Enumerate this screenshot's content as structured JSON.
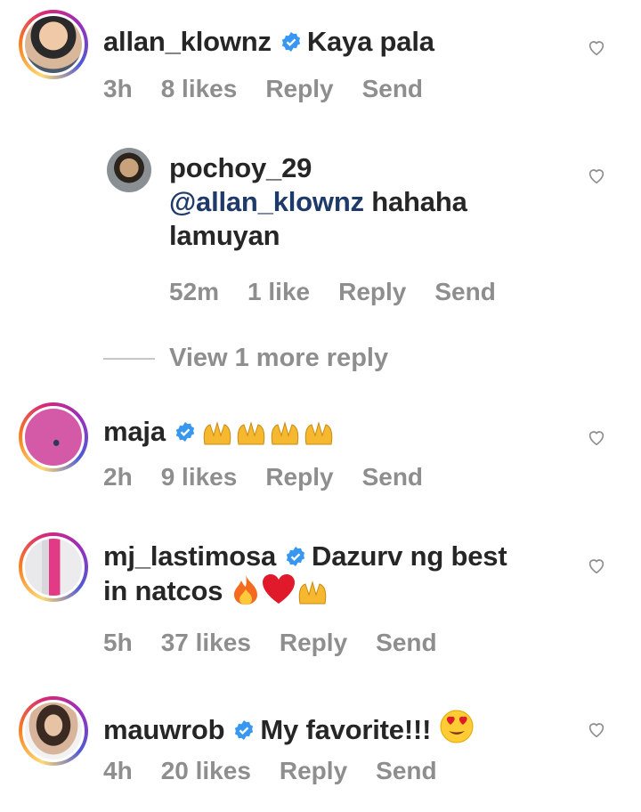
{
  "comments": [
    {
      "username": "allan_klownz",
      "text": "Kaya pala",
      "time": "3h",
      "likes": "8 likes",
      "reply": "Reply",
      "send": "Send"
    },
    {
      "username": "maja",
      "text": "",
      "time": "2h",
      "likes": "9 likes",
      "reply": "Reply",
      "send": "Send"
    },
    {
      "username": "mj_lastimosa",
      "text_line1": "Dazurv ng best",
      "text_line2": "in natcos",
      "time": "5h",
      "likes": "37 likes",
      "reply": "Reply",
      "send": "Send"
    },
    {
      "username": "mauwrob",
      "text": "My favorite!!!",
      "time": "4h",
      "likes": "20 likes",
      "reply": "Reply",
      "send": "Send"
    }
  ],
  "reply": {
    "username": "pochoy_29",
    "mention": "@allan_klownz",
    "text_line1": "hahaha",
    "text_line2": "lamuyan",
    "time": "52m",
    "likes": "1 like",
    "reply": "Reply",
    "send": "Send"
  },
  "view_more_replies": "View 1 more reply",
  "icons": {
    "verified": "verified-badge-icon",
    "like": "heart-outline-icon",
    "emoji_clap": "raised-hands-emoji",
    "emoji_fire": "fire-emoji",
    "emoji_heart": "red-heart-emoji",
    "emoji_love": "heart-eyes-emoji"
  },
  "colors": {
    "verified": "#3897f0",
    "meta": "#8e8e8e",
    "mention": "#1e3a6a"
  }
}
